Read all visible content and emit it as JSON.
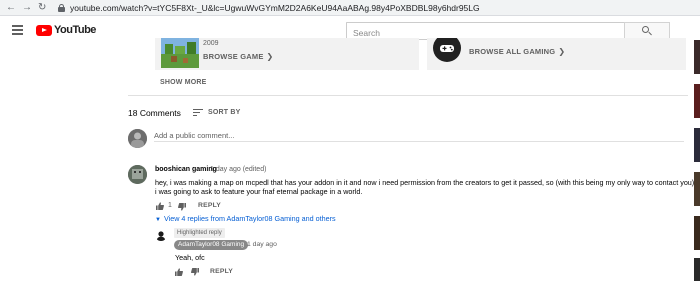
{
  "browser": {
    "url": "youtube.com/watch?v=tYC5F8Xt-_U&lc=UgwuWvGYmM2D2A6KeU94AaABAg.98y4PoXBDBL98y6hdr95LG"
  },
  "masthead": {
    "logo_text": "YouTube",
    "search_placeholder": "Search"
  },
  "category_cards": {
    "game": {
      "year": "2009",
      "label": "BROWSE GAME",
      "chevron": "❯"
    },
    "gaming": {
      "label": "BROWSE ALL GAMING",
      "chevron": "❯"
    }
  },
  "show_more": "SHOW MORE",
  "comments": {
    "count_label": "18 Comments",
    "sort_label": "SORT BY",
    "add_placeholder": "Add a public comment..."
  },
  "comment": {
    "author": "booshican gaming",
    "time": "1 day ago (edited)",
    "text_line1": "hey, i was making a map on mcpedl that has your addon in it and now i need permission from the creators to get it passed, so (with this being my only way to contact you)",
    "text_line2": "i was going to ask to feature your fnaf eternal package in a world.",
    "like_count": "1",
    "reply_label": "REPLY",
    "replies_toggle": "View 4 replies from AdamTaylor08 Gaming and others",
    "caret": "▼"
  },
  "reply": {
    "highlight_label": "Highlighted reply",
    "author": "AdamTaylor08 Gaming",
    "time": "1 day ago",
    "text": "Yeah, ofc",
    "reply_label": "REPLY"
  },
  "colors": {
    "accent_red": "#ff0000",
    "link_blue": "#065fd4",
    "muted_text": "#606060",
    "card_bg": "#f2f2f2"
  },
  "icons": [
    "back-arrow-icon",
    "forward-arrow-icon",
    "reload-icon",
    "lock-icon",
    "menu-icon",
    "youtube-logo-icon",
    "search-icon",
    "gamepad-icon",
    "sort-icon",
    "thumbs-up-icon",
    "thumbs-down-icon"
  ]
}
